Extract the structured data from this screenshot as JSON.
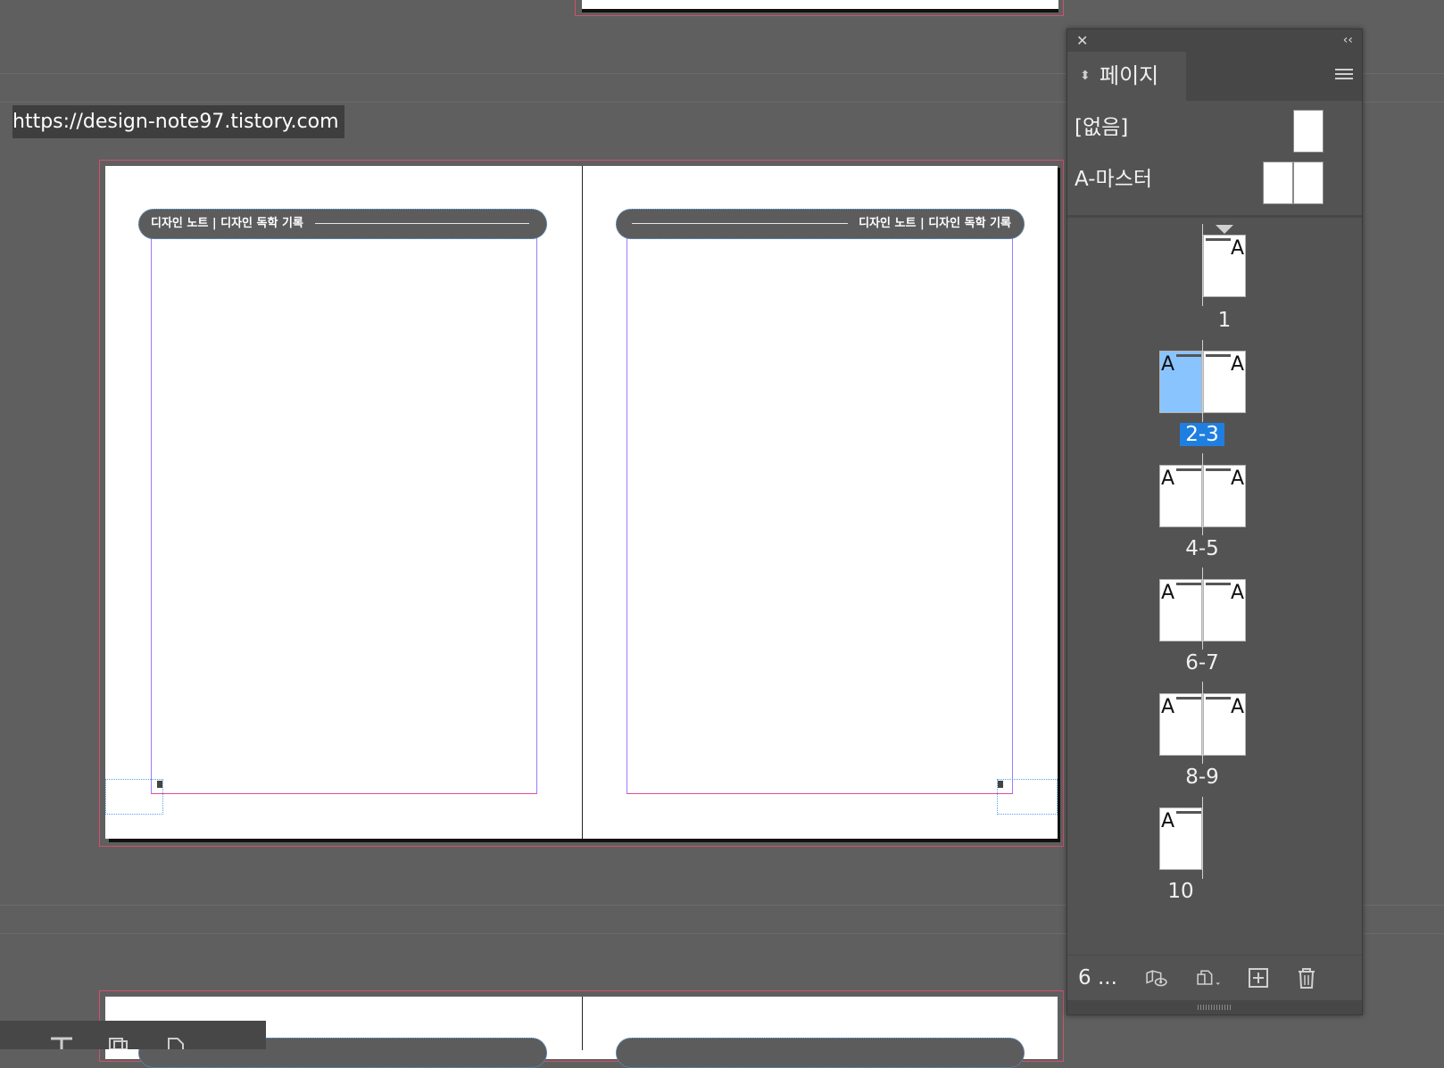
{
  "overlay_url": "https://design-note97.tistory.com",
  "spread": {
    "left_header": "디자인 노트 | 디자인 독학 기록",
    "right_header": "디자인 노트 | 디자인 독학 기록"
  },
  "panel": {
    "tab_label": "페이지",
    "masters": [
      {
        "label": "[없음]"
      },
      {
        "label": "A-마스터"
      }
    ],
    "thumb_marker": "A",
    "pages": [
      {
        "label": "1"
      },
      {
        "label": "2-3",
        "selected": true
      },
      {
        "label": "4-5"
      },
      {
        "label": "6-7"
      },
      {
        "label": "8-9"
      },
      {
        "label": "10"
      }
    ],
    "footer_count": "6 ...",
    "icons": {
      "close": "close-icon",
      "collapse": "collapse-icon",
      "menu": "panel-menu-icon",
      "edit_size": "edit-page-size-icon",
      "new_master": "new-master-icon",
      "new_page": "new-page-icon",
      "delete": "trash-icon"
    }
  }
}
